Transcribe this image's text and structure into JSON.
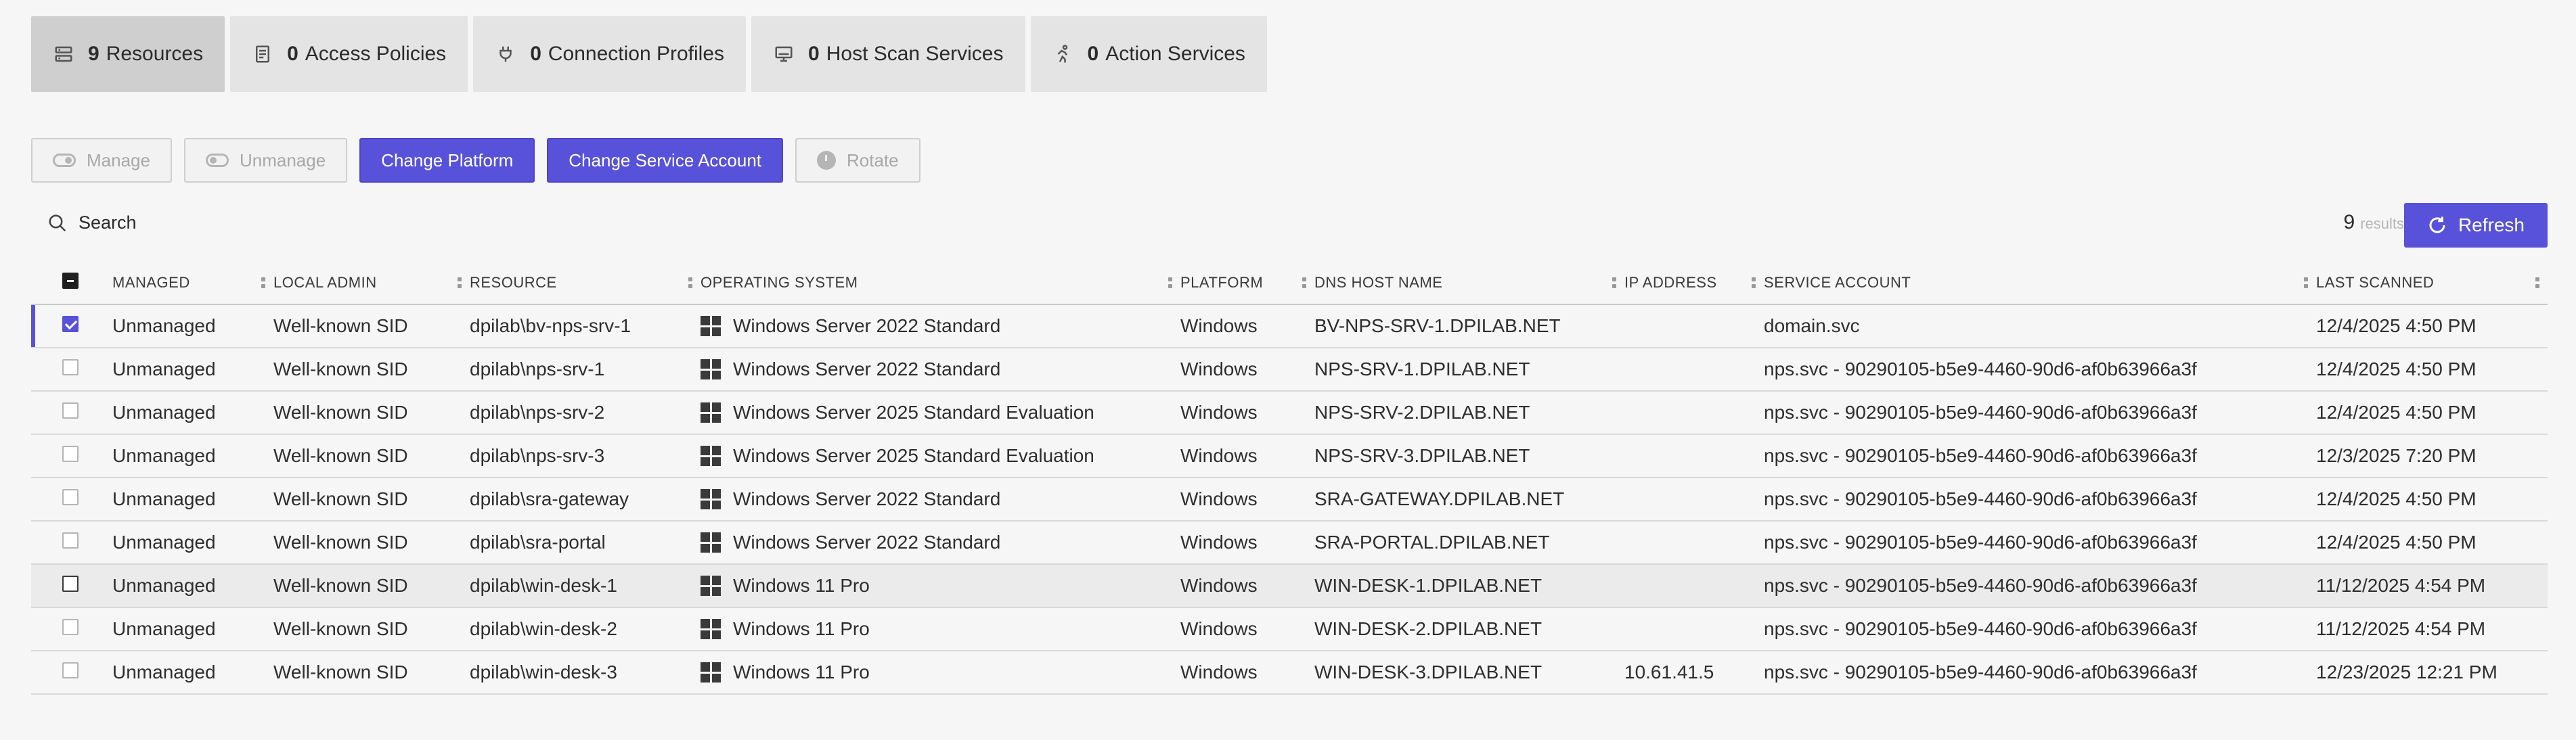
{
  "tabs": [
    {
      "count": "9",
      "label": "Resources",
      "icon": "server-stack-icon",
      "active": true
    },
    {
      "count": "0",
      "label": "Access Policies",
      "icon": "document-icon",
      "active": false
    },
    {
      "count": "0",
      "label": "Connection Profiles",
      "icon": "plug-icon",
      "active": false
    },
    {
      "count": "0",
      "label": "Host Scan Services",
      "icon": "monitor-icon",
      "active": false
    },
    {
      "count": "0",
      "label": "Action Services",
      "icon": "running-person-icon",
      "active": false
    }
  ],
  "toolbar": {
    "manage": "Manage",
    "unmanage": "Unmanage",
    "change_platform": "Change Platform",
    "change_service_account": "Change Service Account",
    "rotate": "Rotate"
  },
  "search": {
    "placeholder": "Search"
  },
  "results": {
    "count": "9",
    "label": "results"
  },
  "refresh": {
    "label": "Refresh"
  },
  "colors": {
    "accent": "#5752d9"
  },
  "table": {
    "columns": [
      "MANAGED",
      "LOCAL ADMIN",
      "RESOURCE",
      "OPERATING SYSTEM",
      "PLATFORM",
      "DNS HOST NAME",
      "IP ADDRESS",
      "SERVICE ACCOUNT",
      "LAST SCANNED"
    ],
    "rows": [
      {
        "checked": true,
        "managed": "Unmanaged",
        "local_admin": "Well-known SID",
        "resource": "dpilab\\bv-nps-srv-1",
        "os": "Windows Server 2022 Standard",
        "platform": "Windows",
        "dns": "BV-NPS-SRV-1.DPILAB.NET",
        "ip": "",
        "service_account": "domain.svc",
        "last_scanned": "12/4/2025 4:50 PM"
      },
      {
        "checked": false,
        "managed": "Unmanaged",
        "local_admin": "Well-known SID",
        "resource": "dpilab\\nps-srv-1",
        "os": "Windows Server 2022 Standard",
        "platform": "Windows",
        "dns": "NPS-SRV-1.DPILAB.NET",
        "ip": "",
        "service_account": "nps.svc - 90290105-b5e9-4460-90d6-af0b63966a3f",
        "last_scanned": "12/4/2025 4:50 PM"
      },
      {
        "checked": false,
        "managed": "Unmanaged",
        "local_admin": "Well-known SID",
        "resource": "dpilab\\nps-srv-2",
        "os": "Windows Server 2025 Standard Evaluation",
        "platform": "Windows",
        "dns": "NPS-SRV-2.DPILAB.NET",
        "ip": "",
        "service_account": "nps.svc - 90290105-b5e9-4460-90d6-af0b63966a3f",
        "last_scanned": "12/4/2025 4:50 PM"
      },
      {
        "checked": false,
        "managed": "Unmanaged",
        "local_admin": "Well-known SID",
        "resource": "dpilab\\nps-srv-3",
        "os": "Windows Server 2025 Standard Evaluation",
        "platform": "Windows",
        "dns": "NPS-SRV-3.DPILAB.NET",
        "ip": "",
        "service_account": "nps.svc - 90290105-b5e9-4460-90d6-af0b63966a3f",
        "last_scanned": "12/3/2025 7:20 PM"
      },
      {
        "checked": false,
        "managed": "Unmanaged",
        "local_admin": "Well-known SID",
        "resource": "dpilab\\sra-gateway",
        "os": "Windows Server 2022 Standard",
        "platform": "Windows",
        "dns": "SRA-GATEWAY.DPILAB.NET",
        "ip": "",
        "service_account": "nps.svc - 90290105-b5e9-4460-90d6-af0b63966a3f",
        "last_scanned": "12/4/2025 4:50 PM"
      },
      {
        "checked": false,
        "managed": "Unmanaged",
        "local_admin": "Well-known SID",
        "resource": "dpilab\\sra-portal",
        "os": "Windows Server 2022 Standard",
        "platform": "Windows",
        "dns": "SRA-PORTAL.DPILAB.NET",
        "ip": "",
        "service_account": "nps.svc - 90290105-b5e9-4460-90d6-af0b63966a3f",
        "last_scanned": "12/4/2025 4:50 PM"
      },
      {
        "checked": false,
        "managed": "Unmanaged",
        "local_admin": "Well-known SID",
        "resource": "dpilab\\win-desk-1",
        "os": "Windows 11 Pro",
        "platform": "Windows",
        "dns": "WIN-DESK-1.DPILAB.NET",
        "ip": "",
        "service_account": "nps.svc - 90290105-b5e9-4460-90d6-af0b63966a3f",
        "last_scanned": "11/12/2025 4:54 PM"
      },
      {
        "checked": false,
        "managed": "Unmanaged",
        "local_admin": "Well-known SID",
        "resource": "dpilab\\win-desk-2",
        "os": "Windows 11 Pro",
        "platform": "Windows",
        "dns": "WIN-DESK-2.DPILAB.NET",
        "ip": "",
        "service_account": "nps.svc - 90290105-b5e9-4460-90d6-af0b63966a3f",
        "last_scanned": "11/12/2025 4:54 PM"
      },
      {
        "checked": false,
        "managed": "Unmanaged",
        "local_admin": "Well-known SID",
        "resource": "dpilab\\win-desk-3",
        "os": "Windows 11 Pro",
        "platform": "Windows",
        "dns": "WIN-DESK-3.DPILAB.NET",
        "ip": "10.61.41.5",
        "service_account": "nps.svc - 90290105-b5e9-4460-90d6-af0b63966a3f",
        "last_scanned": "12/23/2025 12:21 PM"
      }
    ]
  }
}
